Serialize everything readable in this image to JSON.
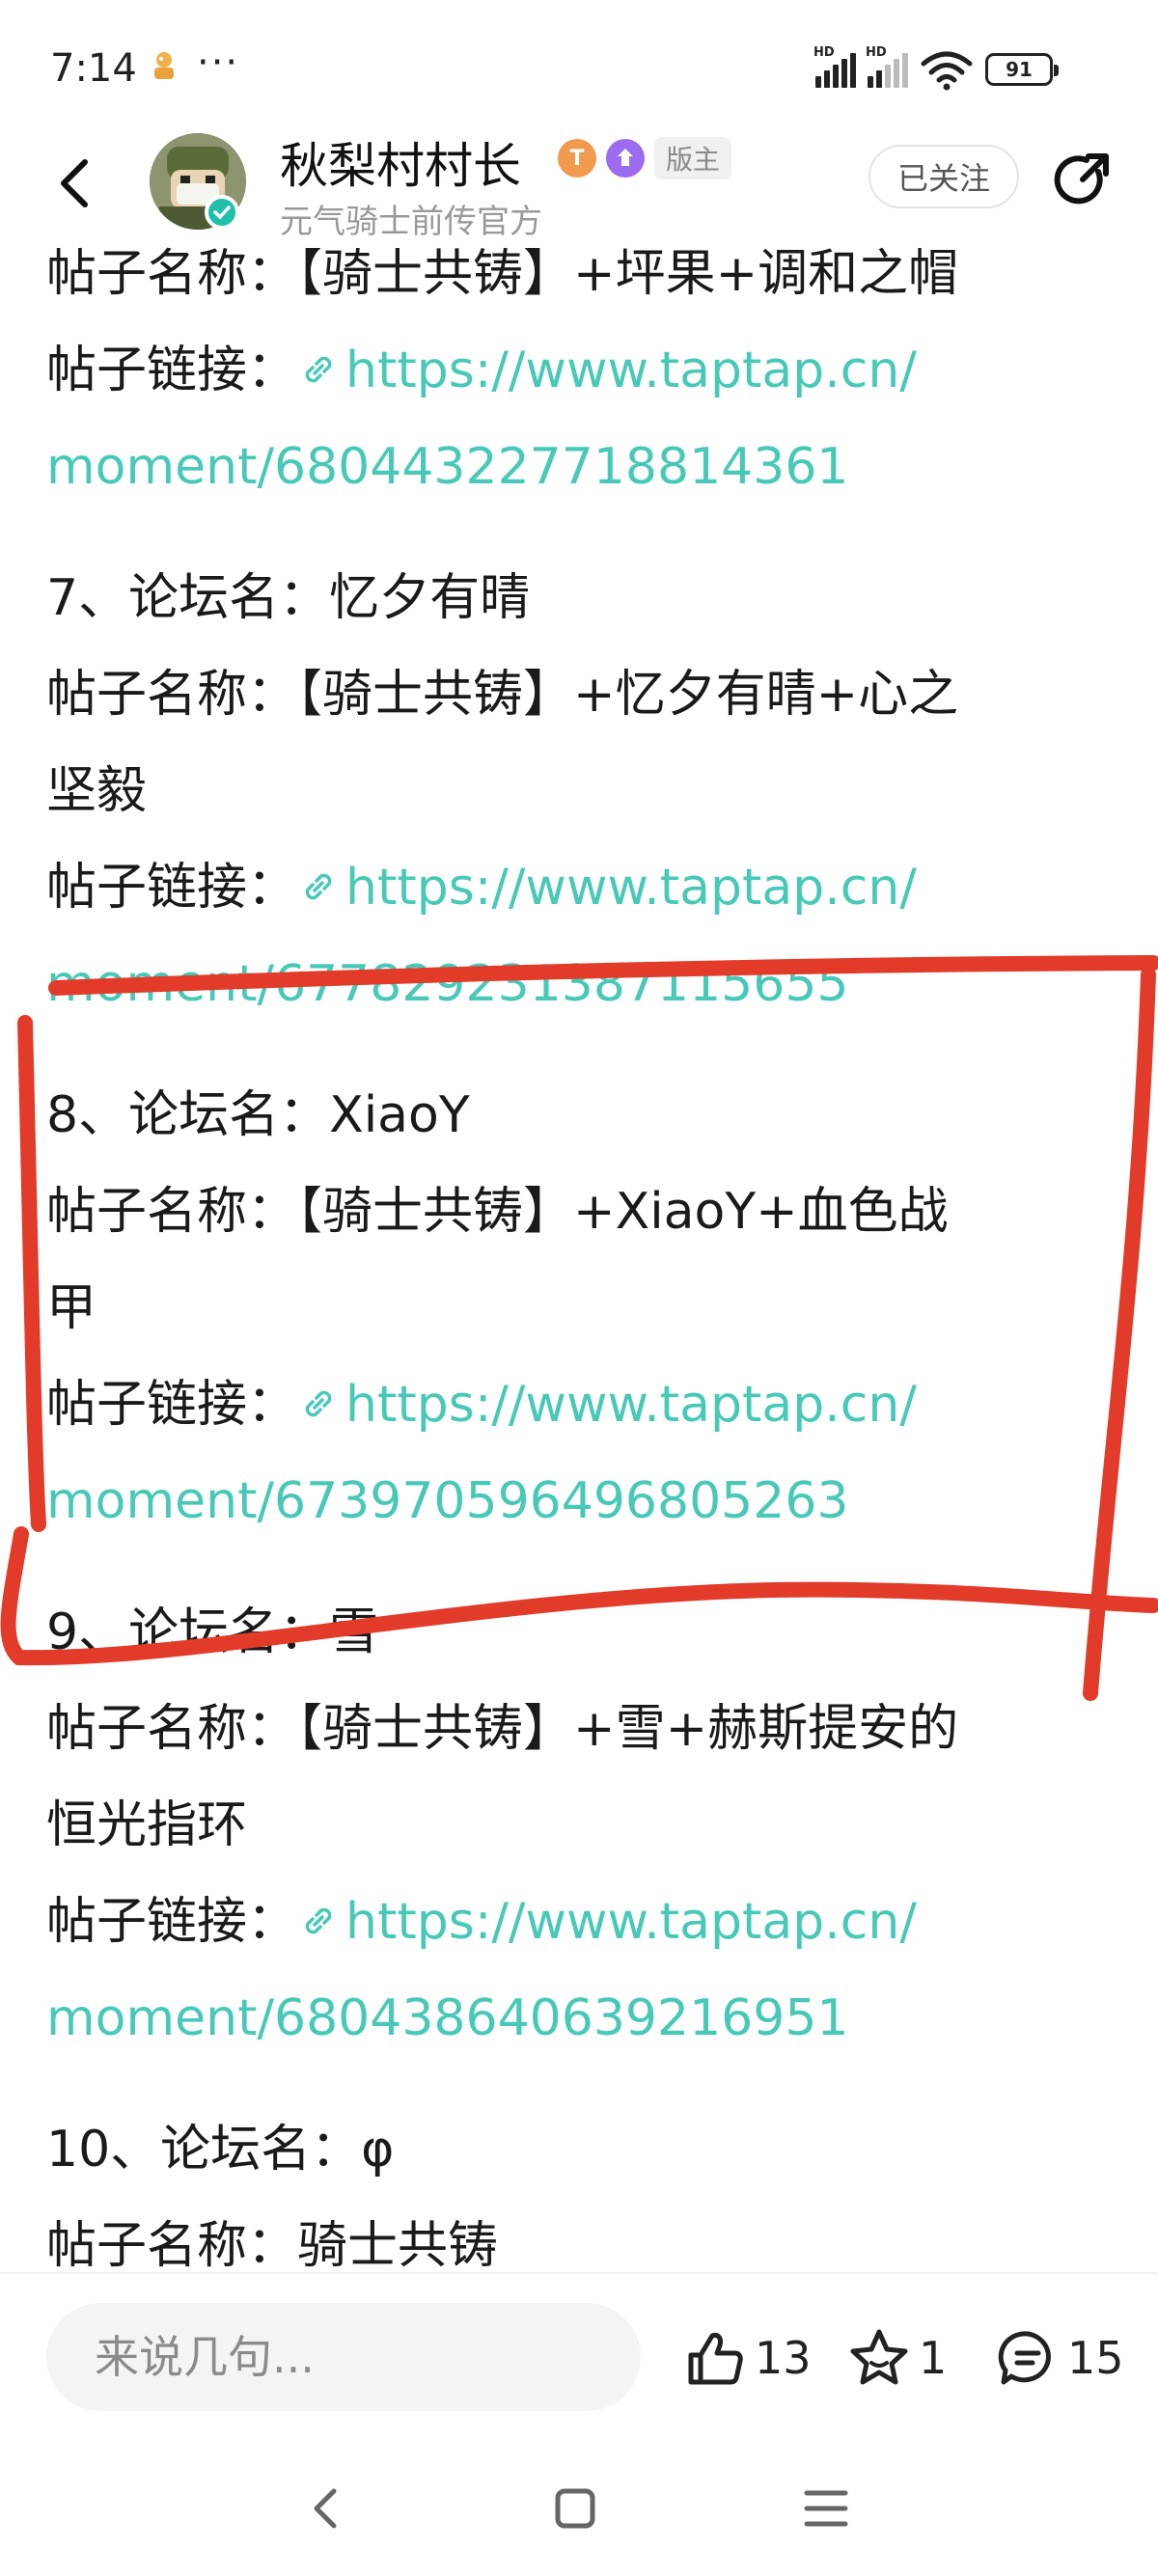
{
  "status_bar": {
    "time": "7:14",
    "signal1_label": "HD",
    "signal2_label": "HD",
    "battery": "91"
  },
  "header": {
    "author_name": "秋梨村村长",
    "level_badge": "T",
    "moderator_badge": "版主",
    "author_subtitle": "元气骑士前传官方",
    "follow_label": "已关注"
  },
  "posts": [
    {
      "lines": [
        {
          "text": "帖子名称：【骑士共铸】+坪果+调和之帽",
          "kind": "text"
        },
        {
          "label": "帖子链接：",
          "url_line1": "https://www.taptap.cn/",
          "url_line2": "moment/680443227718814361",
          "kind": "link"
        }
      ]
    },
    {
      "lines": [
        {
          "text": "7、论坛名：忆夕有晴",
          "kind": "text"
        },
        {
          "text": "帖子名称：【骑士共铸】+忆夕有晴+心之",
          "kind": "text"
        },
        {
          "text": "坚毅",
          "kind": "text"
        },
        {
          "label": "帖子链接：",
          "url_line1": "https://www.taptap.cn/",
          "url_line2": "moment/677829231387115655",
          "kind": "link"
        }
      ]
    },
    {
      "lines": [
        {
          "text": "8、论坛名：XiaoY",
          "kind": "text"
        },
        {
          "text": "帖子名称：【骑士共铸】+XiaoY+血色战",
          "kind": "text"
        },
        {
          "text": "甲",
          "kind": "text"
        },
        {
          "label": "帖子链接：",
          "url_line1": "https://www.taptap.cn/",
          "url_line2": "moment/673970596496805263",
          "kind": "link"
        }
      ]
    },
    {
      "lines": [
        {
          "text": "9、论坛名：雪",
          "kind": "text"
        },
        {
          "text": "帖子名称：【骑士共铸】+雪+赫斯提安的",
          "kind": "text"
        },
        {
          "text": "恒光指环",
          "kind": "text"
        },
        {
          "label": "帖子链接：",
          "url_line1": "https://www.taptap.cn/",
          "url_line2": "moment/680438640639216951",
          "kind": "link"
        }
      ]
    },
    {
      "lines": [
        {
          "text": "10、论坛名：φ",
          "kind": "text"
        },
        {
          "text": "帖子名称：骑士共铸",
          "kind": "text"
        }
      ]
    }
  ],
  "bottom_bar": {
    "comment_placeholder": "来说几句...",
    "like_count": "13",
    "favorite_count": "1",
    "comment_count": "15"
  },
  "colors": {
    "link": "#48c9b8",
    "annotation": "#e23b2a",
    "verified": "#1fbfa9"
  }
}
